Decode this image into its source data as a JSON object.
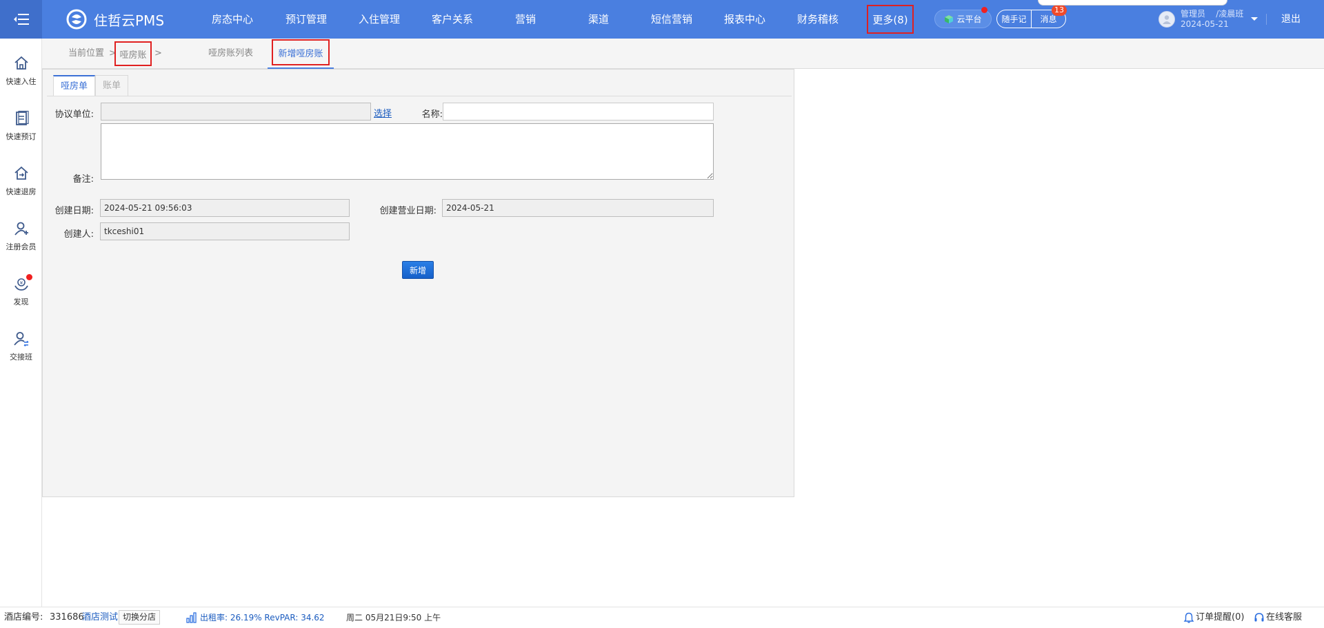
{
  "app": {
    "title": "住哲云PMS"
  },
  "nav": {
    "items": [
      {
        "label": "房态中心"
      },
      {
        "label": "预订管理"
      },
      {
        "label": "入住管理"
      },
      {
        "label": "客户关系"
      },
      {
        "label": "营销"
      },
      {
        "label": "渠道"
      },
      {
        "label": "短信营销"
      },
      {
        "label": "报表中心"
      },
      {
        "label": "财务稽核"
      }
    ],
    "more_label": "更多(8)",
    "cloud_label": "云平台",
    "notes_label": "随手记",
    "messages_label": "消息",
    "messages_count": "13",
    "logout_label": "退出"
  },
  "user": {
    "role": "管理员",
    "shift": "/凌晨班",
    "date": "2024-05-21"
  },
  "sidebar": {
    "items": [
      {
        "label": "快速入住",
        "icon": "home-icon"
      },
      {
        "label": "快速预订",
        "icon": "booking-icon"
      },
      {
        "label": "快速退房",
        "icon": "checkout-icon"
      },
      {
        "label": "注册会员",
        "icon": "add-member-icon"
      },
      {
        "label": "发现",
        "icon": "discover-icon"
      },
      {
        "label": "交接班",
        "icon": "shift-handover-icon"
      }
    ]
  },
  "breadcrumb": {
    "prefix": "当前位置",
    "sep": ">",
    "current": "哑房账"
  },
  "page_tabs": [
    {
      "label": "哑房账列表"
    },
    {
      "label": "新增哑房账"
    }
  ],
  "form": {
    "subtabs": [
      {
        "label": "哑房单"
      },
      {
        "label": "账单"
      }
    ],
    "agreement_unit_label": "协议单位:",
    "agreement_unit_value": "",
    "select_link": "选择",
    "name_label": "名称:",
    "name_value": "",
    "remark_label": "备注:",
    "remark_value": "",
    "create_date_label": "创建日期:",
    "create_date_value": "2024-05-21 09:56:03",
    "business_date_label": "创建营业日期:",
    "business_date_value": "2024-05-21",
    "creator_label": "创建人:",
    "creator_value": "tkceshi01",
    "submit_label": "新增"
  },
  "status": {
    "hotel_no_label": "酒店编号:",
    "hotel_no": "331686",
    "hotel_name": "酒店测试",
    "switch_label": "切换分店",
    "occupancy": "出租率:  26.19%  RevPAR:  34.62",
    "datetime": "周二 05月21日9:50 上午",
    "order_alert": "订单提醒(0)",
    "online_service": "在线客服"
  },
  "colors": {
    "topbar": "#4a7fe0",
    "accent": "#3a70d6",
    "highlight_border": "#e02020",
    "badge": "#f04a2a"
  }
}
